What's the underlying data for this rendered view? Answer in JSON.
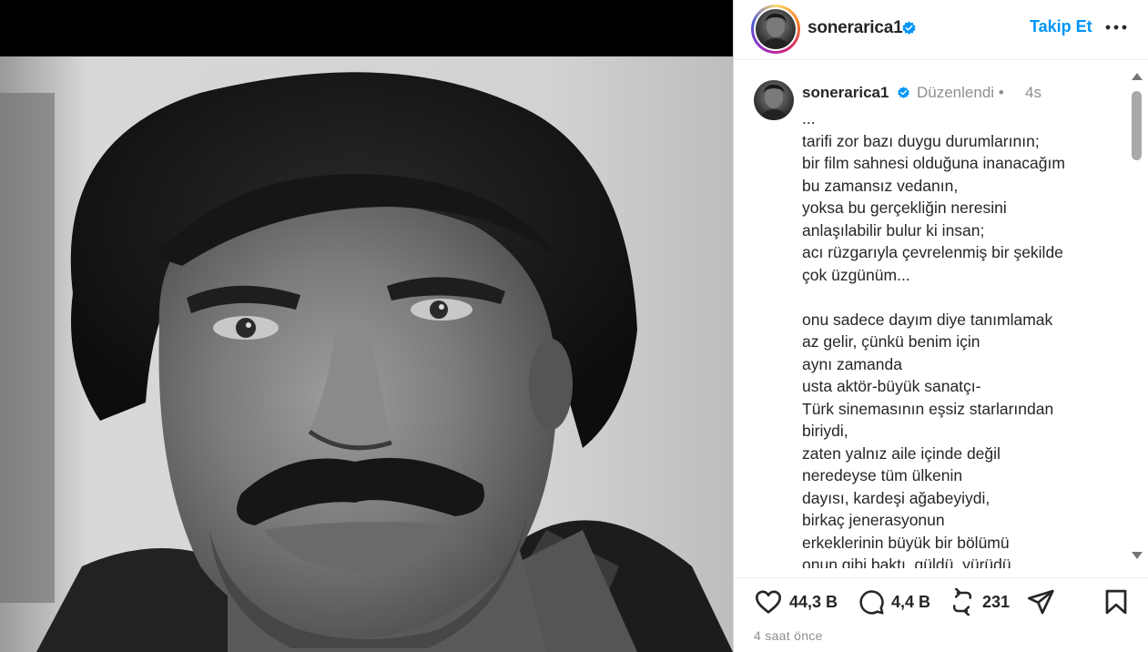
{
  "post": {
    "username": "sonerarica1",
    "follow_label": "Takip Et",
    "photo_alt": "Siyah beyaz portre fotoğrafı"
  },
  "caption": {
    "username": "sonerarica1",
    "edited_label": "Düzenlendi",
    "separator": "•",
    "time": "4s",
    "lines": [
      "...",
      "tarifi zor bazı duygu durumlarının;",
      "bir film sahnesi olduğuna inanacağım",
      "bu zamansız vedanın,",
      "yoksa bu gerçekliğin neresini",
      "anlaşılabilir bulur ki insan;",
      "acı rüzgarıyla çevrelenmiş bir şekilde",
      "çok üzgünüm...",
      "",
      "onu sadece dayım diye tanımlamak",
      "az gelir, çünkü benim için",
      "aynı zamanda",
      "usta aktör-büyük sanatçı-",
      "Türk sinemasının eşsiz starlarından",
      "biriydi,",
      "zaten yalnız aile içinde değil",
      "neredeyse tüm ülkenin",
      "dayısı, kardeşi ağabeyiydi,",
      "birkaç jenerasyonun",
      "erkeklerinin büyük bir bölümü",
      "onun gibi baktı, güldü, yürüdü."
    ]
  },
  "actions": {
    "likes": "44,3 B",
    "comments": "4,4 B",
    "reposts": "231"
  },
  "post_age": "4 saat önce",
  "icons": [
    "verified-badge-icon",
    "more-options-icon",
    "heart-icon",
    "comment-icon",
    "repost-icon",
    "share-icon",
    "bookmark-icon"
  ],
  "colors": {
    "accent": "#0095f6",
    "text": "#262626",
    "muted": "#8e8e8e"
  }
}
